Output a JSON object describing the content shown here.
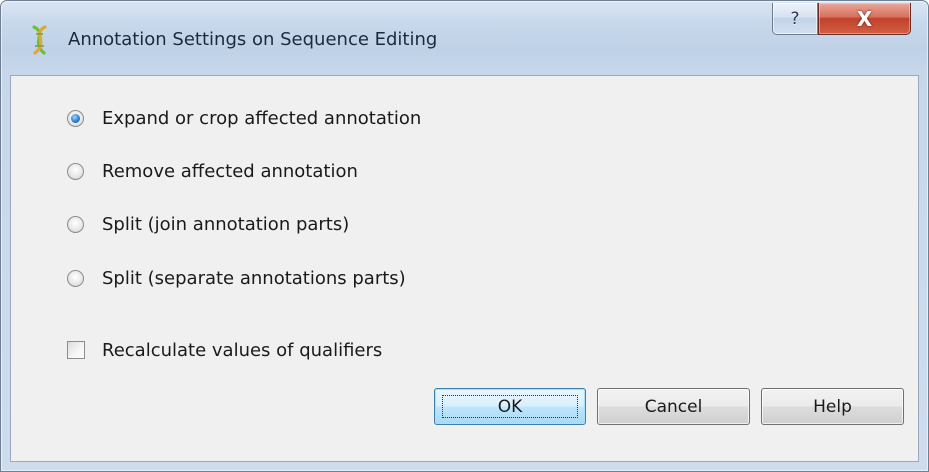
{
  "window": {
    "title": "Annotation Settings on Sequence Editing",
    "app_icon": "ugene-helix-icon",
    "title_buttons": {
      "help_glyph": "?",
      "close_glyph": "X"
    }
  },
  "options": [
    {
      "label": "Expand or crop affected annotation",
      "selected": true
    },
    {
      "label": "Remove affected annotation",
      "selected": false
    },
    {
      "label": "Split (join annotation parts)",
      "selected": false
    },
    {
      "label": "Split (separate annotations parts)",
      "selected": false
    }
  ],
  "recalculate": {
    "label": "Recalculate values of qualifiers",
    "checked": false
  },
  "buttons": {
    "ok": "OK",
    "cancel": "Cancel",
    "help": "Help"
  },
  "colors": {
    "frame": "#c7d7ea",
    "client": "#f0f0f0",
    "close_red": "#c2412a",
    "default_button_border": "#3c7fb1"
  }
}
